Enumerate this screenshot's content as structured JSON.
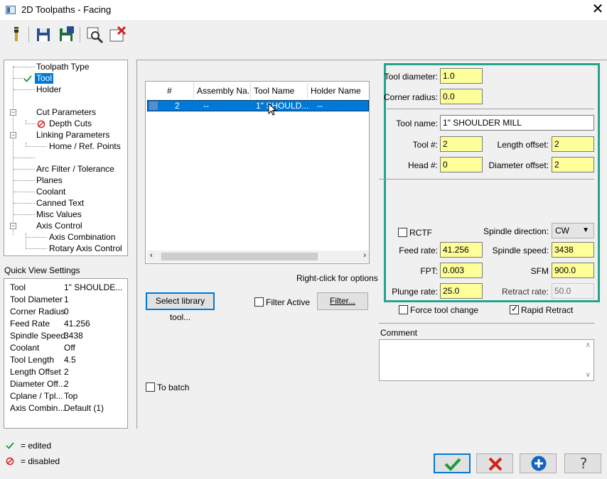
{
  "window": {
    "title": "2D Toolpaths - Facing",
    "close_glyph": "✕"
  },
  "toolbar": {
    "icons": [
      "tool-icon",
      "save-icon",
      "save-all-icon",
      "inspect-icon",
      "delete-icon"
    ]
  },
  "tree": {
    "items": [
      {
        "label": "Toolpath Type"
      },
      {
        "label": "Tool"
      },
      {
        "label": "Holder"
      },
      {
        "label": "Cut Parameters"
      },
      {
        "label": "Depth Cuts"
      },
      {
        "label": "Linking Parameters"
      },
      {
        "label": "Home / Ref. Points"
      },
      {
        "label": "Arc Filter / Tolerance"
      },
      {
        "label": "Planes"
      },
      {
        "label": "Coolant"
      },
      {
        "label": "Canned Text"
      },
      {
        "label": "Misc Values"
      },
      {
        "label": "Axis Control"
      },
      {
        "label": "Axis Combination"
      },
      {
        "label": "Rotary Axis Control"
      }
    ]
  },
  "quick_view": {
    "title": "Quick View Settings",
    "rows": [
      {
        "key": "Tool",
        "value": "1\" SHOULDE..."
      },
      {
        "key": "Tool Diameter",
        "value": "1"
      },
      {
        "key": "Corner Radius",
        "value": "0"
      },
      {
        "key": "Feed Rate",
        "value": "41.256"
      },
      {
        "key": "Spindle Speed",
        "value": "3438"
      },
      {
        "key": "Coolant",
        "value": "Off"
      },
      {
        "key": "Tool Length",
        "value": "4.5"
      },
      {
        "key": "Length Offset",
        "value": "2"
      },
      {
        "key": "Diameter Off...",
        "value": "2"
      },
      {
        "key": "Cplane / Tpl...",
        "value": "Top"
      },
      {
        "key": "Axis Combin...",
        "value": "Default (1)"
      }
    ]
  },
  "legend": {
    "edited": "= edited",
    "disabled": "= disabled"
  },
  "tool_list": {
    "headers": [
      "#",
      "Assembly Na...",
      "Tool Name",
      "Holder Name"
    ],
    "row": {
      "num": "2",
      "assembly": "--",
      "tool": "1\" SHOULD...",
      "holder": "--"
    },
    "hint": "Right-click for options",
    "select_library_btn": "Select library tool...",
    "filter_active": "Filter Active",
    "filter_btn": "Filter...",
    "to_batch": "To batch"
  },
  "params": {
    "tool_diameter_label": "Tool diameter:",
    "tool_diameter": "1.0",
    "corner_radius_label": "Corner radius:",
    "corner_radius": "0.0",
    "tool_name_label": "Tool name:",
    "tool_name": "1\" SHOULDER MILL",
    "tool_num_label": "Tool #:",
    "tool_num": "2",
    "length_offset_label": "Length offset:",
    "length_offset": "2",
    "head_num_label": "Head #:",
    "head_num": "0",
    "diameter_offset_label": "Diameter offset:",
    "diameter_offset": "2",
    "rctf_label": "RCTF",
    "spindle_dir_label": "Spindle direction:",
    "spindle_dir": "CW",
    "feed_rate_label": "Feed rate:",
    "feed_rate": "41.256",
    "spindle_speed_label": "Spindle speed:",
    "spindle_speed": "3438",
    "fpt_label": "FPT:",
    "fpt": "0.003",
    "sfm_label": "SFM",
    "sfm": "900.0",
    "plunge_rate_label": "Plunge rate:",
    "plunge_rate": "25.0",
    "retract_rate_label": "Retract rate:",
    "retract_rate": "50.0",
    "force_tool_change_label": "Force tool change",
    "rapid_retract_label": "Rapid Retract",
    "comment_label": "Comment"
  },
  "colors": {
    "highlight_border": "#22a58b",
    "field_yellow": "#ffff99",
    "selection": "#0078d7"
  }
}
